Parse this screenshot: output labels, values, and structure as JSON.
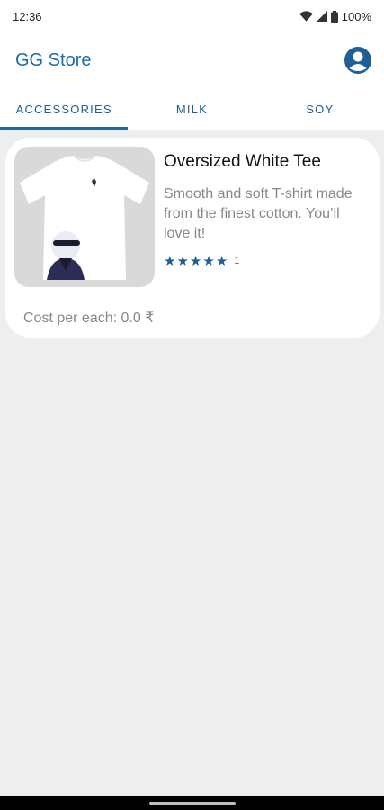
{
  "status": {
    "time": "12:36",
    "battery": "100%",
    "icons": [
      "wifi-icon",
      "signal-icon",
      "battery-icon"
    ]
  },
  "appbar": {
    "title": "GG Store",
    "account_icon": "account-circle-icon"
  },
  "tabs": [
    {
      "label": "ACCESSORIES",
      "active": true
    },
    {
      "label": "MILK",
      "active": false
    },
    {
      "label": "SOY",
      "active": false
    }
  ],
  "products": [
    {
      "title": "Oversized White Tee",
      "description": "Smooth and soft T-shirt made from the finest cotton. You’ll love it!",
      "rating": 5,
      "rating_count": "1",
      "cost": "Cost per each: 0.0 ₹"
    }
  ],
  "colors": {
    "accent": "#1f6aa5",
    "background": "#eeeeee",
    "card": "#ffffff"
  }
}
